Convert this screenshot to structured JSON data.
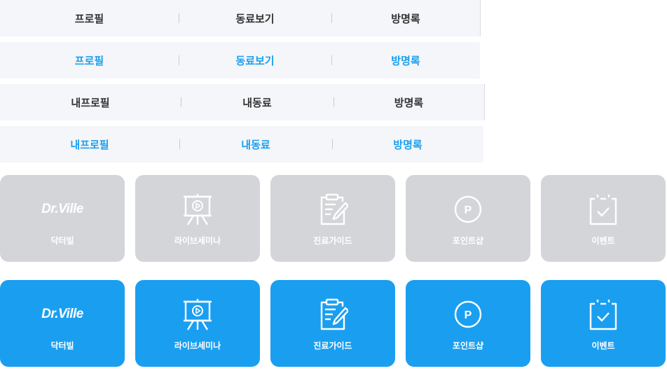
{
  "tabs_a_default": [
    "프로필",
    "동료보기",
    "방명록"
  ],
  "tabs_a_active": [
    "프로필",
    "동료보기",
    "방명록"
  ],
  "tabs_b_default": [
    "내프로필",
    "내동료",
    "방명록"
  ],
  "tabs_b_active": [
    "내프로필",
    "내동료",
    "방명록"
  ],
  "tiles": [
    {
      "label": "닥터빌",
      "icon": "drville-logo",
      "logo_text": "Dr.Ville"
    },
    {
      "label": "라이브세미나",
      "icon": "presentation-play-icon"
    },
    {
      "label": "진료가이드",
      "icon": "clipboard-pen-icon"
    },
    {
      "label": "포인트샵",
      "icon": "point-coin-icon",
      "glyph": "P"
    },
    {
      "label": "이벤트",
      "icon": "calendar-check-icon"
    }
  ],
  "colors": {
    "accent": "#1a9ff0",
    "tile_gray": "#d4d5d9",
    "tab_bg": "#f4f6f9",
    "tab_text": "#333333"
  }
}
